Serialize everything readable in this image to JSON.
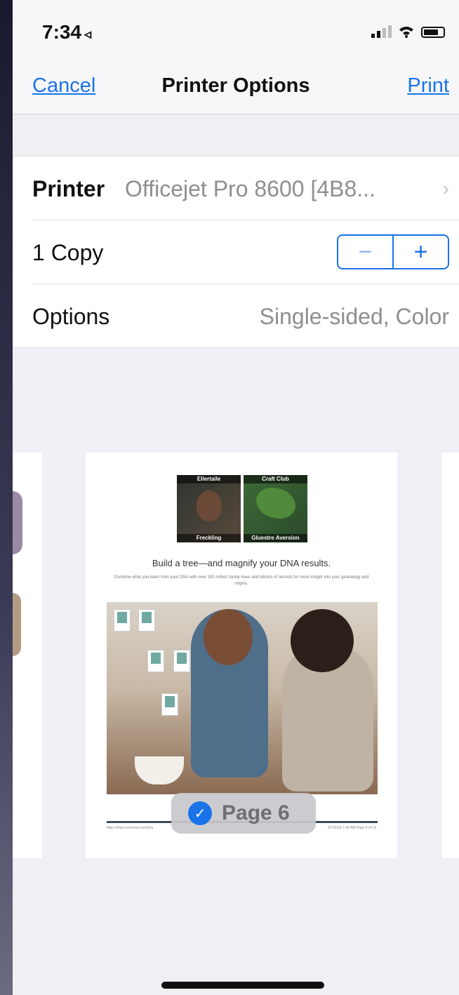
{
  "status_bar": {
    "time": "7:34",
    "location_glyph": "◃",
    "icons": [
      "signal-icon",
      "wifi-icon",
      "battery-icon"
    ]
  },
  "nav": {
    "cancel_label": "Cancel",
    "title": "Printer Options",
    "print_label": "Print"
  },
  "settings": {
    "printer": {
      "label": "Printer",
      "value": "Officejet Pro 8600 [4B8...",
      "chevron": "›"
    },
    "copies": {
      "label": "1 Copy",
      "minus": "−",
      "plus": "+"
    },
    "options": {
      "label": "Options",
      "value": "Single-sided, Color"
    }
  },
  "preview": {
    "tiles": [
      {
        "top": "Ellertaile",
        "bottom": "Freckling"
      },
      {
        "top": "Craft Club",
        "bottom": "Gluestre Aversion"
      }
    ],
    "headline": "Build a tree—and magnify your DNA results.",
    "subtext": "Combine what you learn from your DNA with over 100 million family trees and billions of records for more insight into your genealogy and origins.",
    "footer_left": "https://www.ancestry.com/dna",
    "footer_right": "9/7/2018 7:34 AM Page 6 of 14"
  },
  "page_badge": {
    "check": "✓",
    "label": "Page 6"
  },
  "colors": {
    "accent": "#1a73e8",
    "background": "#efeff4"
  }
}
